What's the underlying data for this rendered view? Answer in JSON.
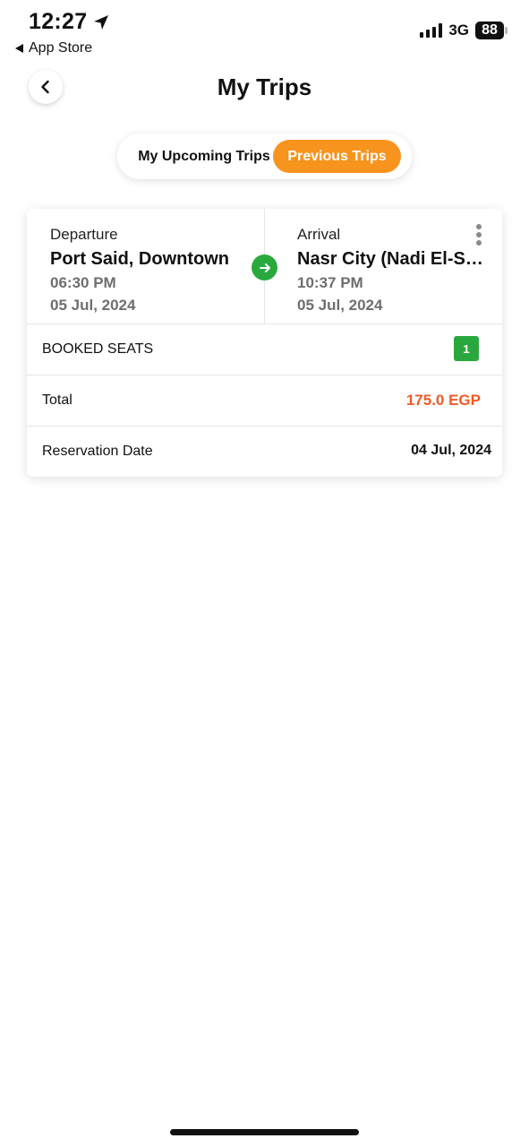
{
  "status_bar": {
    "time": "12:27",
    "back_app": "App Store",
    "network": "3G",
    "battery": "88"
  },
  "header": {
    "title": "My Trips"
  },
  "tabs": {
    "upcoming": "My Upcoming Trips",
    "previous": "Previous Trips",
    "active": "previous"
  },
  "trip": {
    "departure": {
      "label": "Departure",
      "place": "Port Said, Downtown",
      "time": "06:30 PM",
      "date": "05 Jul, 2024"
    },
    "arrival": {
      "label": "Arrival",
      "place": "Nasr City (Nadi El-Sek…",
      "time": "10:37 PM",
      "date": "05 Jul, 2024"
    },
    "booked_seats_label": "BOOKED SEATS",
    "booked_seats": "1",
    "total_label": "Total",
    "total_value": "175.0 EGP",
    "reservation_label": "Reservation Date",
    "reservation_value": "04 Jul, 2024"
  },
  "colors": {
    "accent_orange": "#f7941d",
    "price_orange": "#f15a24",
    "green": "#29a93d"
  },
  "icons": [
    "location-arrow-icon",
    "signal-icon",
    "battery-icon",
    "back-chevron-icon",
    "arrow-right-icon",
    "more-vertical-icon"
  ]
}
